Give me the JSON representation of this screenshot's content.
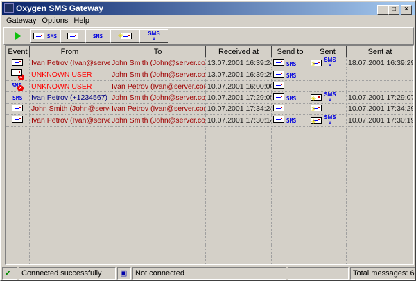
{
  "window": {
    "title": "Oxygen SMS Gateway",
    "min": "_",
    "max": "□",
    "close": "×"
  },
  "menu": [
    "Gateway",
    "Options",
    "Help"
  ],
  "toolbar": {
    "sms_label": "SMS"
  },
  "columns": [
    "Event",
    "From",
    "To",
    "Received at",
    "Send to",
    "Sent",
    "Sent at"
  ],
  "rows": [
    {
      "event": "email",
      "error": false,
      "from": "Ivan Petrov (Ivan@server",
      "from_color": "#a00000",
      "to": "John Smith (John@server.com)",
      "received": "13.07.2001 16:39:24",
      "send_email": true,
      "send_sms": true,
      "sent_email": true,
      "sent_sms": true,
      "sent_at": "18.07.2001 16:39:29"
    },
    {
      "event": "email",
      "error": true,
      "from": "UNKNOWN USER",
      "from_color": "#ff0000",
      "to": "John Smith (John@server.com)",
      "received": "13.07.2001 16:39:29",
      "send_email": true,
      "send_sms": true,
      "sent_email": false,
      "sent_sms": false,
      "sent_at": ""
    },
    {
      "event": "sms",
      "error": true,
      "from": "UNKNOWN USER",
      "from_color": "#ff0000",
      "to": "Ivan Petrov (Ivan@server.com)",
      "received": "10.07.2001 16:00:00",
      "send_email": true,
      "send_sms": false,
      "sent_email": false,
      "sent_sms": false,
      "sent_at": ""
    },
    {
      "event": "sms",
      "error": false,
      "from": "Ivan Petrov (+1234567)",
      "from_color": "#000080",
      "to": "John Smith (John@server.com)",
      "received": "10.07.2001 17:29:05",
      "send_email": true,
      "send_sms": true,
      "sent_email": true,
      "sent_sms": true,
      "sent_at": "10.07.2001 17:29:07"
    },
    {
      "event": "email",
      "error": false,
      "from": "John Smith (John@server.",
      "from_color": "#a00000",
      "to": "Ivan Petrov (Ivan@server.com)",
      "received": "10.07.2001 17:34:24",
      "send_email": true,
      "send_sms": false,
      "sent_email": true,
      "sent_sms": false,
      "sent_at": "10.07.2001 17:34:29"
    },
    {
      "event": "email",
      "error": false,
      "from": "Ivan Petrov (Ivan@server",
      "from_color": "#a00000",
      "to": "John Smith (John@server.com)",
      "received": "10.07.2001 17:30:14",
      "send_email": true,
      "send_sms": true,
      "sent_email": true,
      "sent_sms": true,
      "sent_at": "10.07.2001 17:30:19"
    }
  ],
  "status": {
    "gateway": "Connected successfully",
    "mail": "Not connected",
    "extra": "",
    "total": "Total messages: 6"
  }
}
